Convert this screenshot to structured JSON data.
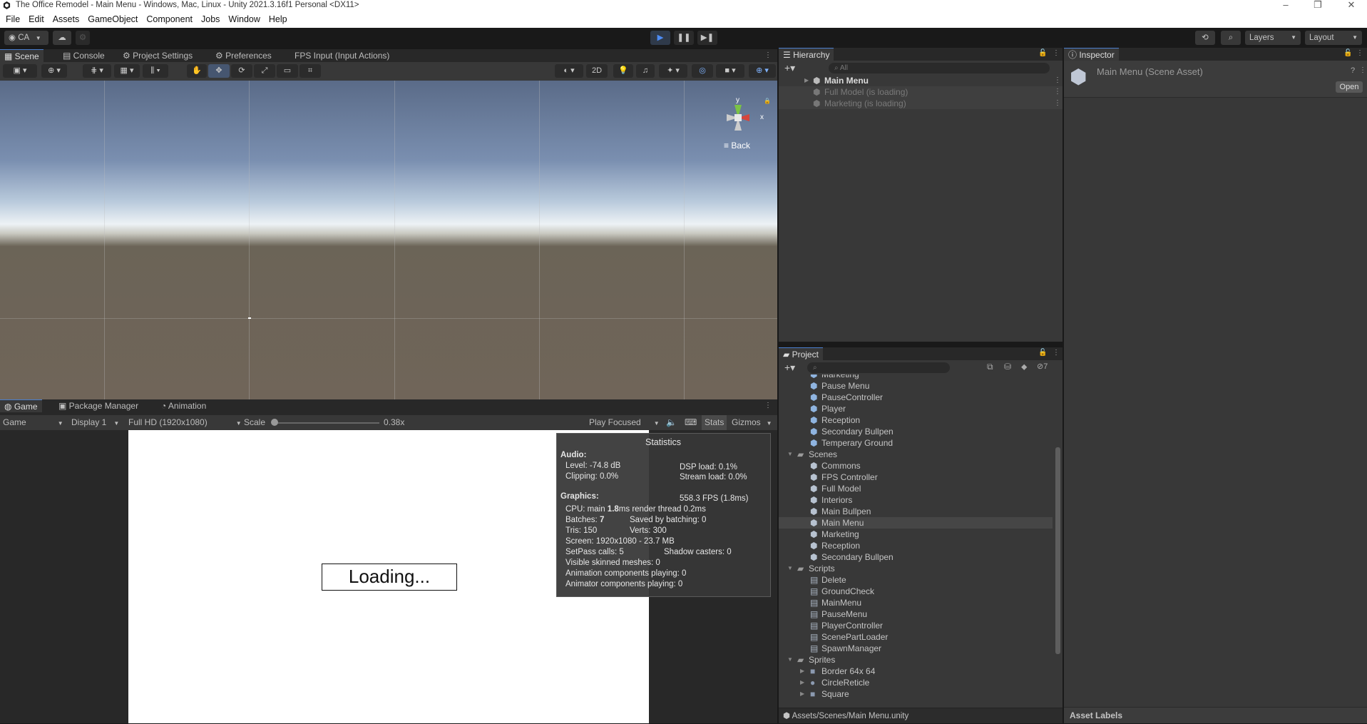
{
  "title": "The Office Remodel - Main Menu - Windows, Mac, Linux - Unity 2021.3.16f1 Personal <DX11>",
  "menu": [
    "File",
    "Edit",
    "Assets",
    "GameObject",
    "Component",
    "Jobs",
    "Window",
    "Help"
  ],
  "toolbar": {
    "account": "CA",
    "layers": "Layers",
    "layout": "Layout"
  },
  "scene_tabs": {
    "scene": "Scene",
    "console": "Console",
    "project_settings": "Project Settings",
    "preferences": "Preferences",
    "fps_input": "FPS Input (Input Actions)"
  },
  "scene_toolbar": {
    "mode_2d": "2D"
  },
  "gizmo": {
    "y": "y",
    "x": "x",
    "back": "Back"
  },
  "hierarchy": {
    "tab": "Hierarchy",
    "search_placeholder": "All",
    "items": [
      {
        "label": "Main Menu"
      },
      {
        "label": "Full Model (is loading)"
      },
      {
        "label": "Marketing (is loading)"
      }
    ]
  },
  "inspector": {
    "tab": "Inspector",
    "asset_name": "Main Menu (Scene Asset)",
    "open": "Open",
    "asset_labels": "Asset Labels"
  },
  "project": {
    "tab": "Project",
    "hidden_count": "7",
    "items": [
      {
        "label": "Marketing",
        "kind": "prefab"
      },
      {
        "label": "Pause Menu",
        "kind": "prefab"
      },
      {
        "label": "PauseController",
        "kind": "prefab"
      },
      {
        "label": "Player",
        "kind": "prefab"
      },
      {
        "label": "Reception",
        "kind": "prefab"
      },
      {
        "label": "Secondary Bullpen",
        "kind": "prefab"
      },
      {
        "label": "Temperary Ground",
        "kind": "prefab"
      },
      {
        "label": "Scenes",
        "kind": "folder"
      },
      {
        "label": "Commons",
        "kind": "scene"
      },
      {
        "label": "FPS Controller",
        "kind": "scene"
      },
      {
        "label": "Full Model",
        "kind": "scene"
      },
      {
        "label": "Interiors",
        "kind": "scene"
      },
      {
        "label": "Main Bullpen",
        "kind": "scene"
      },
      {
        "label": "Main Menu",
        "kind": "scene",
        "selected": true
      },
      {
        "label": "Marketing",
        "kind": "scene"
      },
      {
        "label": "Reception",
        "kind": "scene"
      },
      {
        "label": "Secondary Bullpen",
        "kind": "scene"
      },
      {
        "label": "Scripts",
        "kind": "folder"
      },
      {
        "label": "Delete",
        "kind": "script"
      },
      {
        "label": "GroundCheck",
        "kind": "script"
      },
      {
        "label": "MainMenu",
        "kind": "script"
      },
      {
        "label": "PauseMenu",
        "kind": "script"
      },
      {
        "label": "PlayerController",
        "kind": "script"
      },
      {
        "label": "ScenePartLoader",
        "kind": "script"
      },
      {
        "label": "SpawnManager",
        "kind": "script"
      },
      {
        "label": "Sprites",
        "kind": "folder"
      },
      {
        "label": "Border 64x 64",
        "kind": "sprite"
      },
      {
        "label": "CircleReticle",
        "kind": "sprite-circle"
      },
      {
        "label": "Square",
        "kind": "sprite"
      }
    ],
    "path": "Assets/Scenes/Main Menu.unity"
  },
  "game_tabs": {
    "game": "Game",
    "package_manager": "Package Manager",
    "animation": "Animation"
  },
  "game_toolbar": {
    "view": "Game",
    "display": "Display 1",
    "resolution": "Full HD (1920x1080)",
    "scale_label": "Scale",
    "scale_value": "0.38x",
    "play_focused": "Play Focused",
    "stats": "Stats",
    "gizmos": "Gizmos"
  },
  "game_view": {
    "loading": "Loading..."
  },
  "stats": {
    "title": "Statistics",
    "audio": "Audio:",
    "level": "Level: -74.8 dB",
    "dsp": "DSP load: 0.1%",
    "clipping": "Clipping: 0.0%",
    "stream": "Stream load: 0.0%",
    "graphics": "Graphics:",
    "fps": "558.3 FPS (1.8ms)",
    "cpu_prefix": "CPU: main ",
    "cpu_main": "1.8",
    "cpu_suffix": "ms  render thread 0.2ms",
    "batches_prefix": "Batches: ",
    "batches": "7",
    "saved": "Saved by batching: 0",
    "tris": "Tris: 150",
    "verts": "Verts: 300",
    "screen": "Screen: 1920x1080 - 23.7 MB",
    "setpass": "SetPass calls: 5",
    "shadow": "Shadow casters: 0",
    "skinned": "Visible skinned meshes: 0",
    "anim": "Animation components playing: 0",
    "animator": "Animator components playing: 0"
  },
  "colors": {
    "accent": "#4a7fcf",
    "play_blue": "#4d8cf5",
    "panel": "#383838",
    "tabbar": "#282828"
  }
}
